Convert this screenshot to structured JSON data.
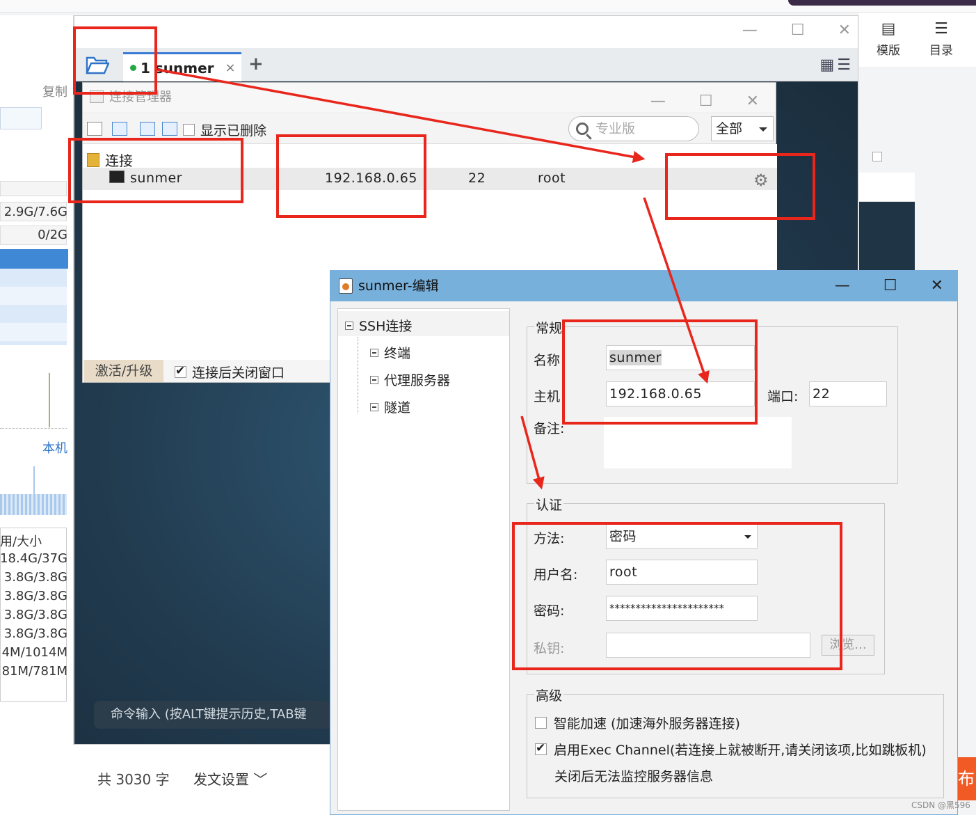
{
  "editor_toolbar": {
    "template_label": "模版",
    "toc_label": "目录"
  },
  "left_panel": {
    "copy_label": "复制",
    "mem": "2.9G/7.6G",
    "swap": "0/2G",
    "local_label": "本机",
    "disk_header": "用/大小",
    "disks": [
      "18.4G/37G",
      "3.8G/3.8G",
      "3.8G/3.8G",
      "3.8G/3.8G",
      "3.8G/3.8G",
      "4M/1014M",
      "81M/781M"
    ]
  },
  "main_window": {
    "tab_label": "1 sunmer",
    "tab_close": "×",
    "add_tab": "+",
    "command_input": "命令输入 (按ALT键提示历史,TAB键"
  },
  "conn_manager": {
    "title": "连接管理器",
    "show_deleted": "显示已删除",
    "search_placeholder": "专业版",
    "filter_selected": "全部",
    "folder": "连接",
    "row": {
      "name": "sunmer",
      "host": "192.168.0.65",
      "port": "22",
      "user": "root"
    },
    "activate": "激活/升级",
    "close_after_connect": "连接后关闭窗口"
  },
  "edit_dialog": {
    "title": "sunmer-编辑",
    "tree": {
      "root": "SSH连接",
      "children": [
        "终端",
        "代理服务器",
        "隧道"
      ]
    },
    "general": {
      "legend": "常规",
      "name_label": "名称",
      "name_value": "sunmer",
      "host_label": "主机",
      "host_value": "192.168.0.65",
      "port_label": "端口:",
      "port_value": "22",
      "note_label": "备注:"
    },
    "auth": {
      "legend": "认证",
      "method_label": "方法:",
      "method_value": "密码",
      "user_label": "用户名:",
      "user_value": "root",
      "password_label": "密码:",
      "password_value": "**********************",
      "key_label": "私钥:",
      "browse": "浏览..."
    },
    "advanced": {
      "legend": "高级",
      "smart_accel": "智能加速 (加速海外服务器连接)",
      "exec_channel": "启用Exec Channel(若连接上就被断开,请关闭该项,比如跳板机)",
      "exec_note": "关闭后无法监控服务器信息"
    }
  },
  "bottom": {
    "word_count": "共 3030 字",
    "publish_settings": "发文设置",
    "publish_tail": "布博",
    "watermark": "CSDN @黑596"
  },
  "colors": {
    "annotation": "#e8261c",
    "title_bar": "#78b0dc",
    "terminal_bg": "#213a4e"
  }
}
